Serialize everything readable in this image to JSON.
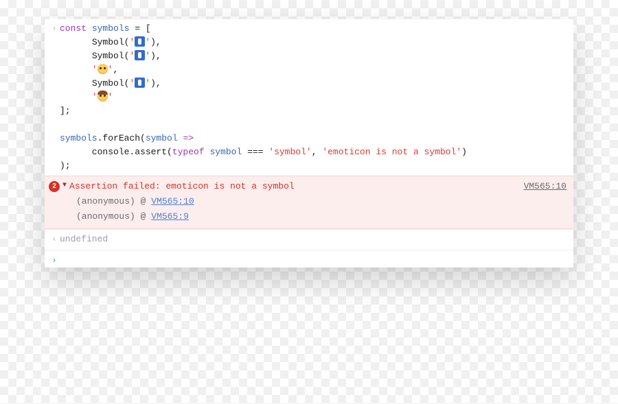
{
  "code": {
    "l1a": "const",
    "l1b": " ",
    "l1c": "symbols",
    "l1d": " = [",
    "indent2": "      ",
    "sym_call": "Symbol",
    "po": "(",
    "pc": ")",
    "comma": ",",
    "q": "'",
    "l7": "];",
    "blank": "",
    "l9a": "symbols",
    "l9b": ".forEach(",
    "l9c": "symbol",
    "l9d": " ",
    "l9e": "=>",
    "l10a": "      console.assert(",
    "l10b": "typeof",
    "l10c": " ",
    "l10d": "symbol",
    "l10e": " === ",
    "l10f": "'symbol'",
    "l10g": ", ",
    "l10h": "'emoticon is not a symbol'",
    "l10i": ")",
    "l11": ");"
  },
  "error": {
    "count": "2",
    "message": "Assertion failed: emoticon is not a symbol",
    "source": "VM565:10",
    "stack": [
      {
        "label": "(anonymous)",
        "at": "@",
        "loc": "VM565:10"
      },
      {
        "label": "(anonymous)",
        "at": "@",
        "loc": "VM565:9"
      }
    ]
  },
  "result": "undefined",
  "glyphs": {
    "input": "›",
    "output": "‹",
    "prompt": "›",
    "triangle": "▼"
  }
}
